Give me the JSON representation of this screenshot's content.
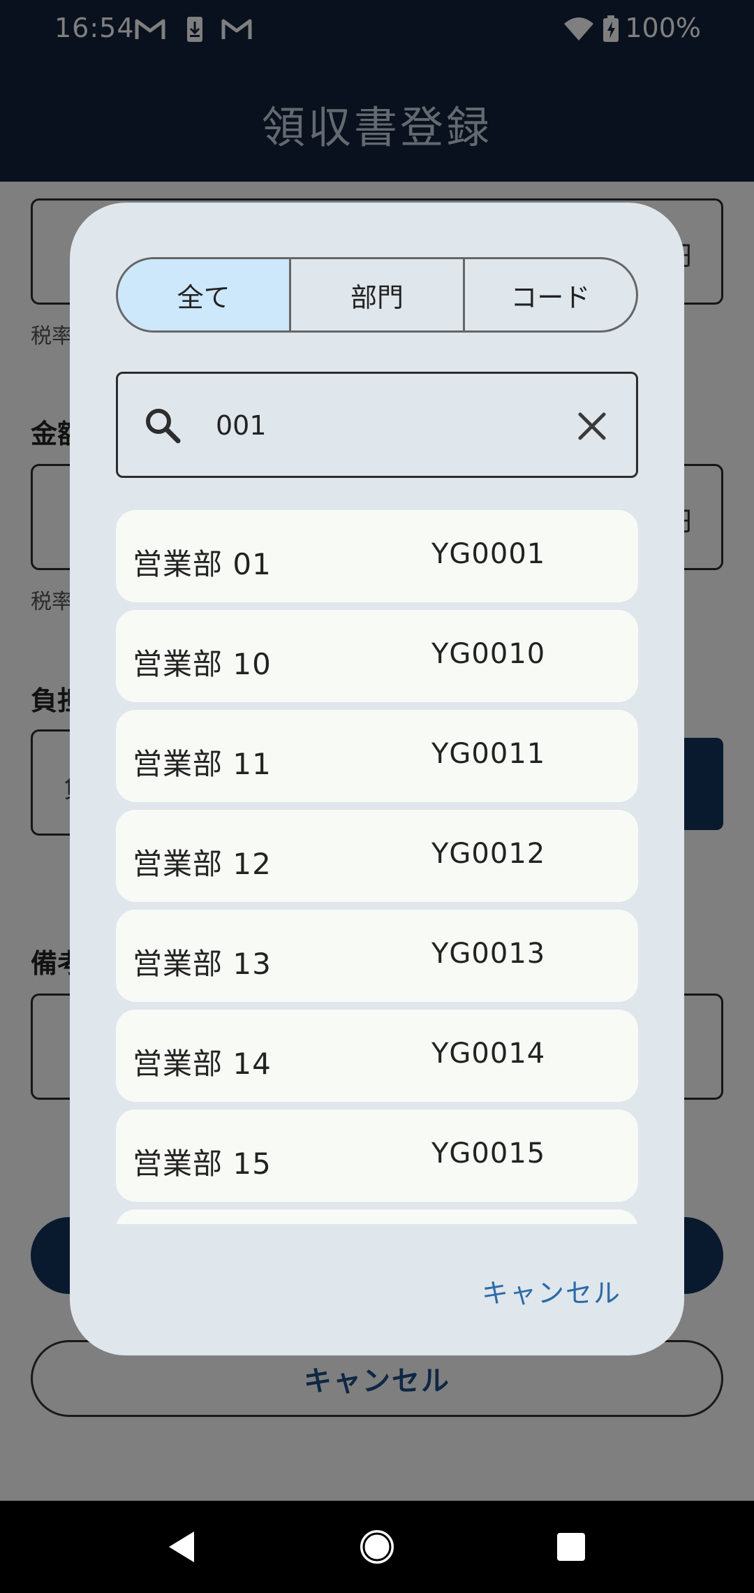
{
  "status_bar": {
    "time": "16:54",
    "battery": "100%"
  },
  "app_bar": {
    "title": "領収書登録"
  },
  "background_form": {
    "yen_suffix": "円",
    "tax_helper_1": "税率",
    "amount_label": "金額",
    "tax_helper_2": "税率",
    "burden_label": "負担",
    "burden_field_text": "負",
    "remarks_label": "備考",
    "cancel_label": "キャンセル"
  },
  "dialog": {
    "segments": [
      {
        "label": "全て",
        "selected": true
      },
      {
        "label": "部門",
        "selected": false
      },
      {
        "label": "コード",
        "selected": false
      }
    ],
    "search": {
      "value": "001"
    },
    "items": [
      {
        "name": "営業部 01",
        "code": "YG0001"
      },
      {
        "name": "営業部 10",
        "code": "YG0010"
      },
      {
        "name": "営業部 11",
        "code": "YG0011"
      },
      {
        "name": "営業部 12",
        "code": "YG0012"
      },
      {
        "name": "営業部 13",
        "code": "YG0013"
      },
      {
        "name": "営業部 14",
        "code": "YG0014"
      },
      {
        "name": "営業部 15",
        "code": "YG0015"
      }
    ],
    "cancel_label": "キャンセル"
  },
  "colors": {
    "app_bar": "#13233d",
    "primary": "#13345f",
    "dialog_bg": "#dfe6ec",
    "segment_selected": "#cde7fb",
    "list_item_bg": "#f8faf5",
    "accent_text": "#2b6aa6"
  }
}
